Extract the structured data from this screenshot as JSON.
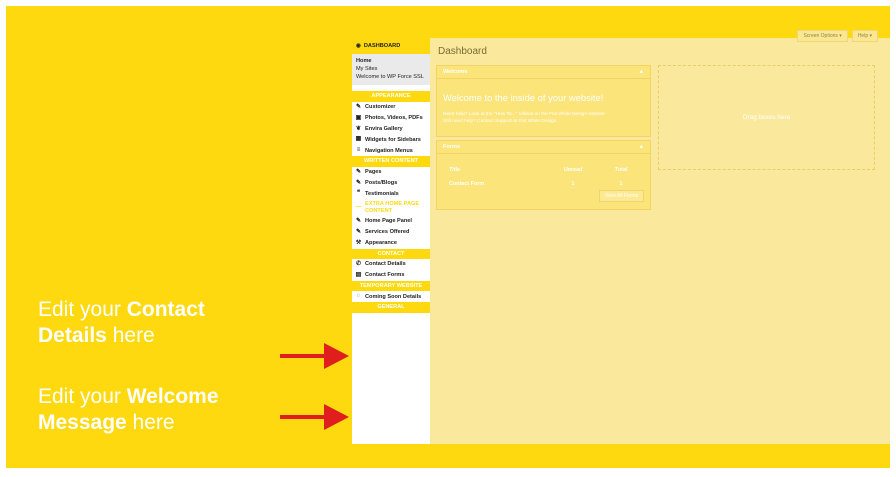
{
  "sidebar": {
    "dashboard": "DASHBOARD",
    "sub": [
      "Home",
      "My Sites",
      "Welcome to WP Force SSL"
    ],
    "appearance_head": "APPEARANCE",
    "customizer": "Customizer",
    "photos": "Photos, Videos, PDFs",
    "envira": "Envira Gallery",
    "widgets": "Widgets for Sidebars",
    "nav_menus": "Navigation Menus",
    "written_head": "WRITTEN CONTENT",
    "pages": "Pages",
    "posts": "Posts/Blogs",
    "testimonials": "Testimonials",
    "extra": "EXTRA HOME PAGE CONTENT",
    "home_panel": "Home Page Panel",
    "services": "Services Offered",
    "appearance_item": "Appearance",
    "contact_head": "CONTACT",
    "contact_details": "Contact Details",
    "contact_forms": "Contact Forms",
    "temp_head": "TEMPORARY WEBSITE",
    "coming_soon": "Coming Soon Details",
    "general_head": "GENERAL"
  },
  "main": {
    "title": "Dashboard",
    "screen_options": "Screen Options ▾",
    "help": "Help ▾",
    "welcome_box": {
      "heading": "Welcome",
      "big": "Welcome to the inside of your website!",
      "help1": "Need help? Look at the \"How To...\" Videos on the Flat White Design website.",
      "help2": "Still need help? Contact Support at Flat White Design."
    },
    "forms_box": {
      "heading": "Forms",
      "col_title": "Title",
      "col_unread": "Unread",
      "col_total": "Total",
      "row_title": "Contact Form",
      "row_unread": "1",
      "row_total": "1",
      "view_all": "View All Forms"
    },
    "drag": "Drag boxes here",
    "toggle": "▲"
  },
  "callouts": {
    "c1_pre": "Edit your ",
    "c1_bold1": "Contact",
    "c1_bold2": "Details",
    "c1_post": " here",
    "c2_pre": "Edit your ",
    "c2_bold1": "Welcome",
    "c2_bold2": "Message",
    "c2_post": " here"
  },
  "colors": {
    "slide_bg": "#ffd90f",
    "arrow": "#e01e1e",
    "main_bg": "#fae99c"
  }
}
